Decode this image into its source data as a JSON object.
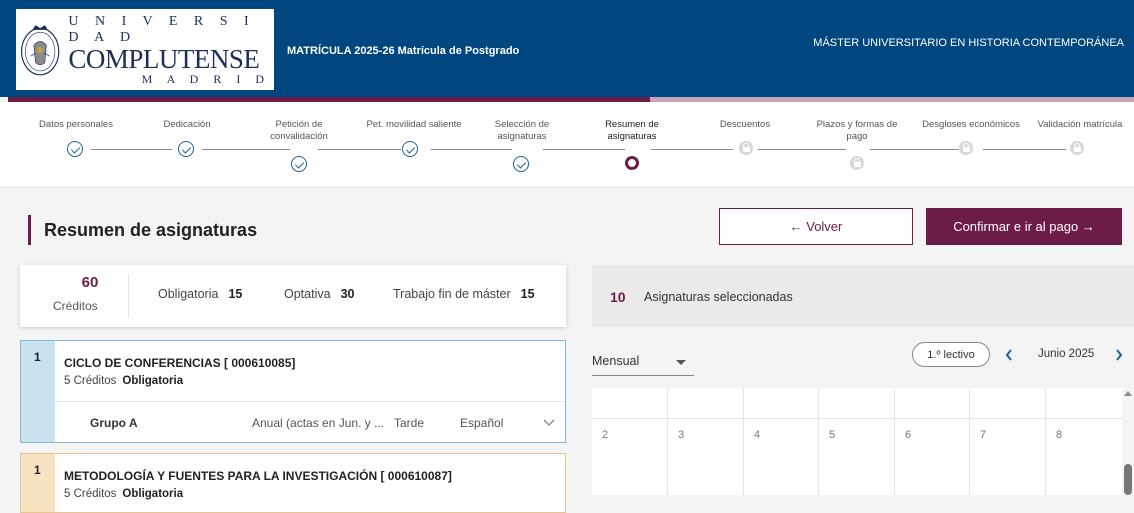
{
  "header": {
    "logo_line1": "U N I V E R S I D A D",
    "logo_line2": "COMPLUTENSE",
    "logo_line3": "M A D R I D",
    "title": "MATRÍCULA 2025-26 Matrícula de Postgrado",
    "program": "MÁSTER UNIVERSITARIO EN HISTORIA CONTEMPORÁNEA"
  },
  "progress": {
    "fraction": 0.57
  },
  "steps": [
    {
      "label": "Datos personales",
      "state": "done"
    },
    {
      "label": "Dedicación",
      "state": "done"
    },
    {
      "label": "Petición de convalidación",
      "state": "done"
    },
    {
      "label": "Pet. movilidad saliente",
      "state": "done"
    },
    {
      "label": "Selección de asignaturas",
      "state": "done"
    },
    {
      "label": "Resumen de asignaturas",
      "state": "current"
    },
    {
      "label": "Descuentos",
      "state": "locked"
    },
    {
      "label": "Plazos y formas de pago",
      "state": "locked"
    },
    {
      "label": "Desgloses económicos",
      "state": "locked"
    },
    {
      "label": "Validación matrícula",
      "state": "locked"
    }
  ],
  "page": {
    "title": "Resumen de asignaturas",
    "back_label": "← Volver",
    "confirm_label": "Confirmar e ir al pago →"
  },
  "summary": {
    "credits_value": "60",
    "credits_label": "Créditos",
    "obligatoria_label": "Obligatoria",
    "obligatoria_value": "15",
    "optativa_label": "Optativa",
    "optativa_value": "30",
    "tfm_label": "Trabajo fin de máster",
    "tfm_value": "15"
  },
  "selected": {
    "count": "10",
    "label": "Asignaturas seleccionadas"
  },
  "courses": [
    {
      "number": "1",
      "title": "CICLO DE CONFERENCIAS [ 000610085]",
      "credits": "5 Créditos",
      "type": "Obligatoria",
      "group": "Grupo A",
      "period": "Anual (actas en Jun. y ...",
      "shift": "Tarde",
      "language": "Español",
      "stripe_color": "#c9e2ee",
      "border_color": "#7fb8d6"
    },
    {
      "number": "1",
      "title": "METODOLOGÍA Y FUENTES PARA LA INVESTIGACIÓN [ 000610087]",
      "credits": "5 Créditos",
      "type": "Obligatoria",
      "stripe_color": "#f7e3c2",
      "border_color": "#e8c58e"
    }
  ],
  "calendar": {
    "view": "Mensual",
    "term": "1.º lectivo",
    "month": "Junio 2025",
    "days": [
      "2",
      "3",
      "4",
      "5",
      "6",
      "7",
      "8"
    ]
  },
  "colors": {
    "header_bg": "#00467f",
    "accent": "#6b1d47",
    "link": "#1a5fa0"
  },
  "icons": [
    "university-seal-icon",
    "check-circle-icon",
    "current-step-icon",
    "lock-icon",
    "arrow-left-icon",
    "arrow-right-icon",
    "chevron-left-icon",
    "chevron-right-icon",
    "chevron-down-icon",
    "caret-down-icon"
  ]
}
